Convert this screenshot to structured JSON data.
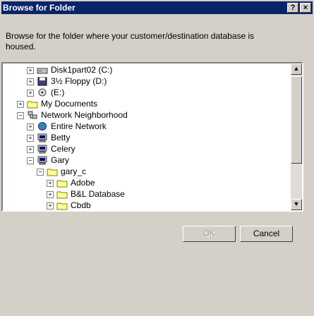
{
  "window": {
    "title": "Browse for Folder",
    "help_label": "?",
    "close_label": "×"
  },
  "prompt": "Browse for the folder where your customer/destination database is housed.",
  "tree": {
    "items": [
      {
        "label": "Disk1part02 (C:)",
        "icon": "hard-drive-icon",
        "expander": "+"
      },
      {
        "label": "3½ Floppy (D:)",
        "icon": "floppy-icon",
        "expander": "+"
      },
      {
        "label": "(E:)",
        "icon": "cd-drive-icon",
        "expander": "+"
      },
      {
        "label": "My Documents",
        "icon": "folder-icon",
        "expander": "+"
      },
      {
        "label": "Network Neighborhood",
        "icon": "network-icon",
        "expander": "−"
      },
      {
        "label": "Entire Network",
        "icon": "globe-icon",
        "expander": "+"
      },
      {
        "label": "Betty",
        "icon": "computer-icon",
        "expander": "+"
      },
      {
        "label": "Celery",
        "icon": "computer-icon",
        "expander": "+"
      },
      {
        "label": "Gary",
        "icon": "computer-icon",
        "expander": "−"
      },
      {
        "label": "gary_c",
        "icon": "folder-icon",
        "expander": "−"
      },
      {
        "label": "Adobe",
        "icon": "folder-icon",
        "expander": "+"
      },
      {
        "label": "B&L Database",
        "icon": "folder-icon",
        "expander": "+"
      },
      {
        "label": "Cbdb",
        "icon": "folder-icon",
        "expander": "+"
      }
    ]
  },
  "buttons": {
    "ok_label": "OK",
    "cancel_label": "Cancel"
  },
  "colors": {
    "title_bar": "#0a246a",
    "face": "#d4d0c8",
    "tree_background": "#ffffff"
  }
}
